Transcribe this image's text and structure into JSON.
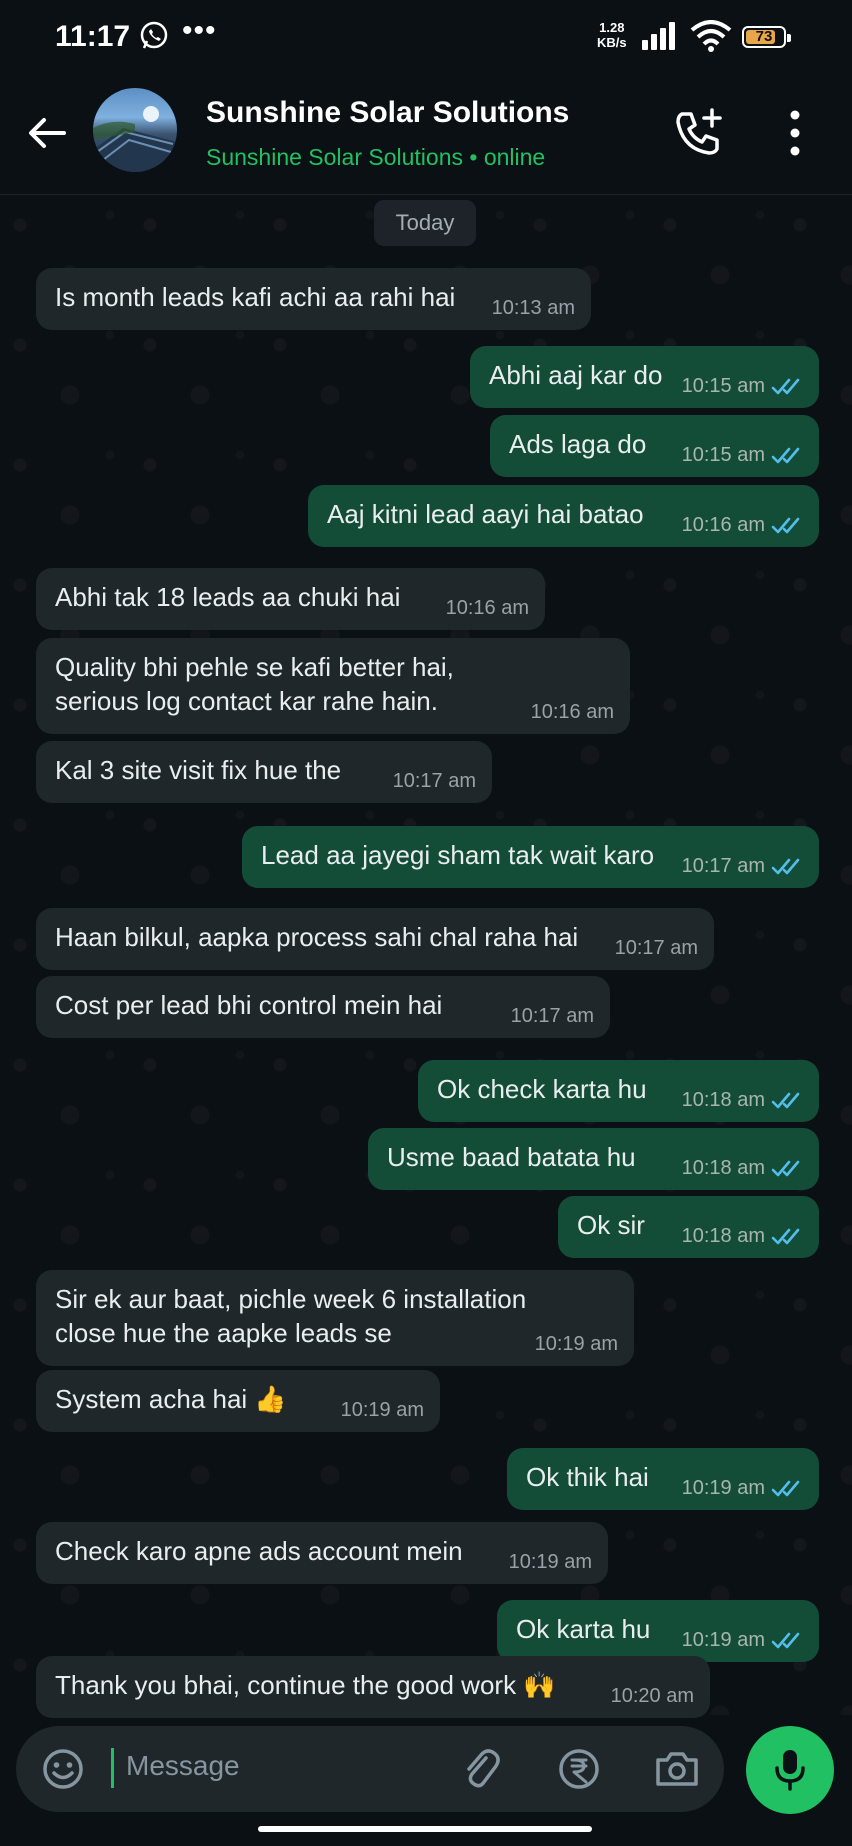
{
  "status_bar": {
    "time": "11:17",
    "speed_value": "1.28",
    "speed_unit": "KB/s",
    "battery": "73"
  },
  "header": {
    "title": "Sunshine Solar Solutions",
    "subtitle": "Sunshine Solar Solutions • online"
  },
  "date_chip": "Today",
  "messages": [
    {
      "dir": "in",
      "lines": [
        "Is month leads kafi achi aa rahi hai"
      ],
      "time": "10:13 am"
    },
    {
      "dir": "out",
      "lines": [
        "Abhi aaj kar do"
      ],
      "time": "10:15 am",
      "read": true
    },
    {
      "dir": "out",
      "lines": [
        "Ads laga do"
      ],
      "time": "10:15 am",
      "read": true
    },
    {
      "dir": "out",
      "lines": [
        "Aaj kitni lead aayi hai batao"
      ],
      "time": "10:16 am",
      "read": true
    },
    {
      "dir": "in",
      "lines": [
        "Abhi tak 18 leads aa chuki hai"
      ],
      "time": "10:16 am"
    },
    {
      "dir": "in",
      "lines": [
        "Quality bhi pehle se kafi better hai,",
        "serious log contact kar rahe hain."
      ],
      "time": "10:16 am"
    },
    {
      "dir": "in",
      "lines": [
        "Kal 3 site visit fix hue the"
      ],
      "time": "10:17 am"
    },
    {
      "dir": "out",
      "lines": [
        "Lead aa jayegi sham tak wait karo"
      ],
      "time": "10:17 am",
      "read": true
    },
    {
      "dir": "in",
      "lines": [
        "Haan bilkul, aapka process sahi chal raha hai"
      ],
      "time": "10:17 am"
    },
    {
      "dir": "in",
      "lines": [
        "Cost per lead bhi control mein hai"
      ],
      "time": "10:17 am"
    },
    {
      "dir": "out",
      "lines": [
        "Ok check karta hu"
      ],
      "time": "10:18 am",
      "read": true
    },
    {
      "dir": "out",
      "lines": [
        "Usme baad batata hu"
      ],
      "time": "10:18 am",
      "read": true
    },
    {
      "dir": "out",
      "lines": [
        "Ok sir"
      ],
      "time": "10:18 am",
      "read": true
    },
    {
      "dir": "in",
      "lines": [
        "Sir ek aur baat, pichle week 6 installation",
        "close hue the aapke leads se"
      ],
      "time": "10:19 am"
    },
    {
      "dir": "in",
      "lines": [
        "System acha hai 👍"
      ],
      "time": "10:19 am"
    },
    {
      "dir": "out",
      "lines": [
        "Ok thik hai"
      ],
      "time": "10:19 am",
      "read": true
    },
    {
      "dir": "in",
      "lines": [
        "Check karo apne ads account mein"
      ],
      "time": "10:19 am"
    },
    {
      "dir": "out",
      "lines": [
        "Ok karta hu"
      ],
      "time": "10:19 am",
      "read": true
    },
    {
      "dir": "in",
      "lines": [
        "Thank you bhai, continue the good work 🙌"
      ],
      "time": "10:20 am"
    }
  ],
  "input": {
    "placeholder": "Message"
  },
  "colors": {
    "accent": "#21c063",
    "outgoing_bubble": "#134d37",
    "incoming_bubble": "#1f272b",
    "read_ticks": "#53bdeb"
  }
}
